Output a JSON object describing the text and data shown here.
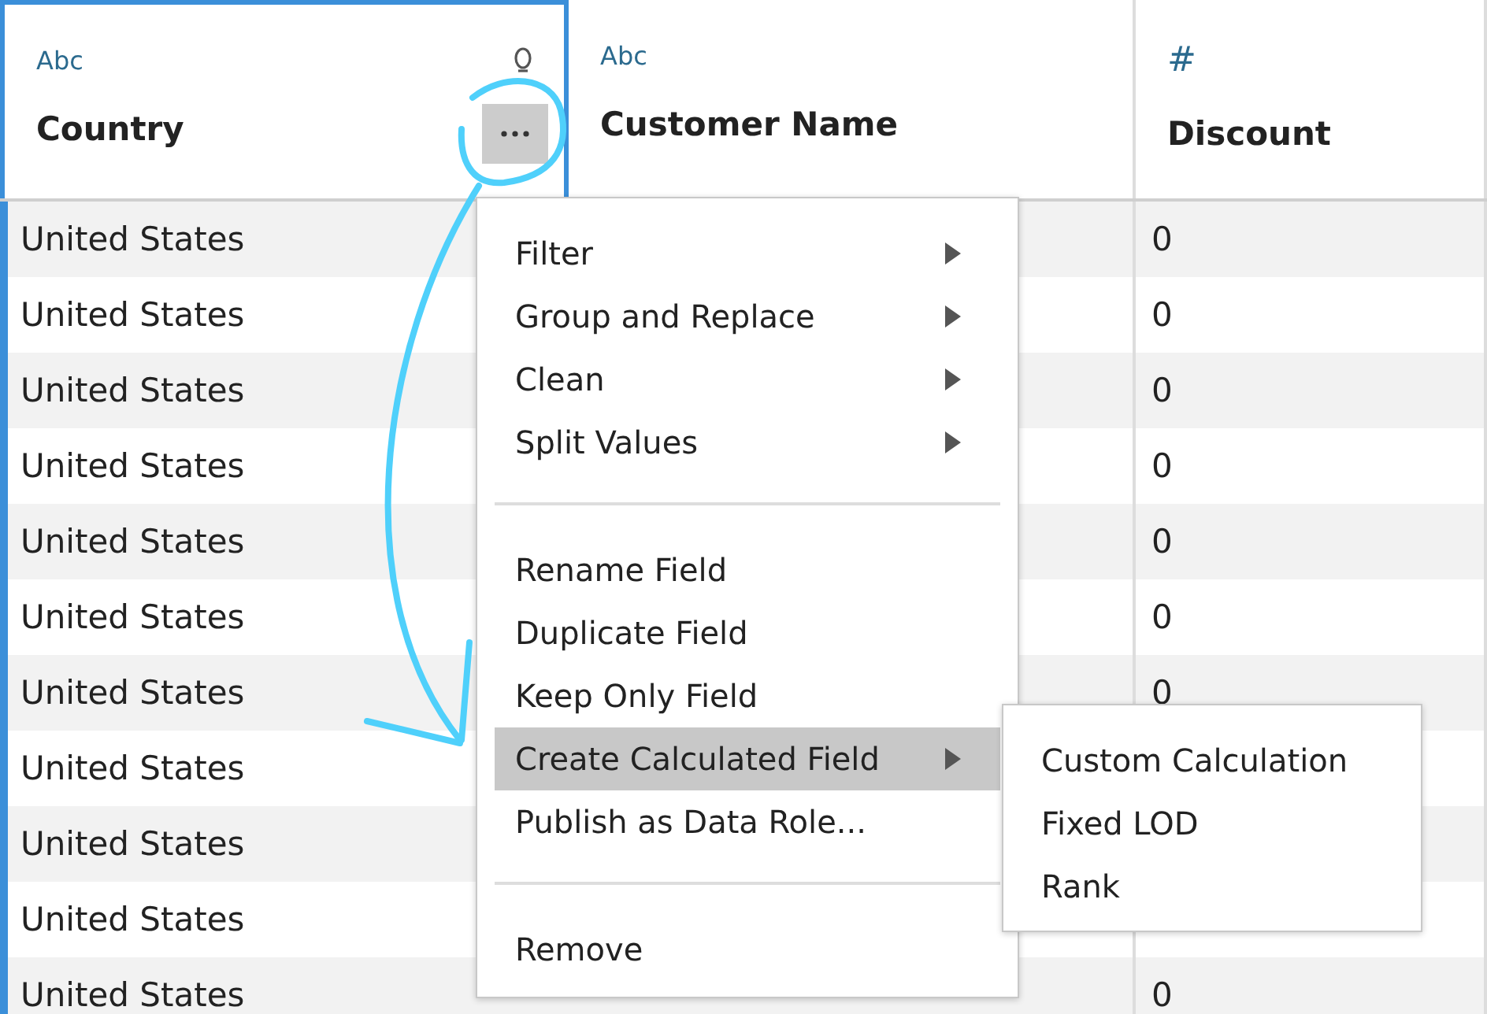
{
  "columns": [
    {
      "type": "Abc",
      "kind": "text",
      "name": "Country",
      "selected": true
    },
    {
      "type": "Abc",
      "kind": "text",
      "name": "Customer Name",
      "selected": false
    },
    {
      "type": "#",
      "kind": "number",
      "name": "Discount",
      "selected": false
    }
  ],
  "rows": [
    {
      "country": "United States",
      "discount": "0"
    },
    {
      "country": "United States",
      "discount": "0"
    },
    {
      "country": "United States",
      "discount": "0"
    },
    {
      "country": "United States",
      "discount": "0"
    },
    {
      "country": "United States",
      "discount": "0"
    },
    {
      "country": "United States",
      "discount": "0"
    },
    {
      "country": "United States",
      "discount": "0"
    },
    {
      "country": "United States"
    },
    {
      "country": "United States"
    },
    {
      "country": "United States"
    },
    {
      "country": "United States",
      "discount": "0"
    }
  ],
  "menu": {
    "groups": [
      [
        {
          "label": "Filter",
          "submenu": true,
          "selected": false
        },
        {
          "label": "Group and Replace",
          "submenu": true,
          "selected": false
        },
        {
          "label": "Clean",
          "submenu": true,
          "selected": false
        },
        {
          "label": "Split Values",
          "submenu": true,
          "selected": false
        }
      ],
      [
        {
          "label": "Rename Field",
          "submenu": false,
          "selected": false
        },
        {
          "label": "Duplicate Field",
          "submenu": false,
          "selected": false
        },
        {
          "label": "Keep Only Field",
          "submenu": false,
          "selected": false
        },
        {
          "label": "Create Calculated Field",
          "submenu": true,
          "selected": true
        },
        {
          "label": "Publish as Data Role...",
          "submenu": false,
          "selected": false
        }
      ],
      [
        {
          "label": "Remove",
          "submenu": false,
          "selected": false
        }
      ]
    ],
    "submenu": [
      "Custom Calculation",
      "Fixed LOD",
      "Rank"
    ]
  }
}
